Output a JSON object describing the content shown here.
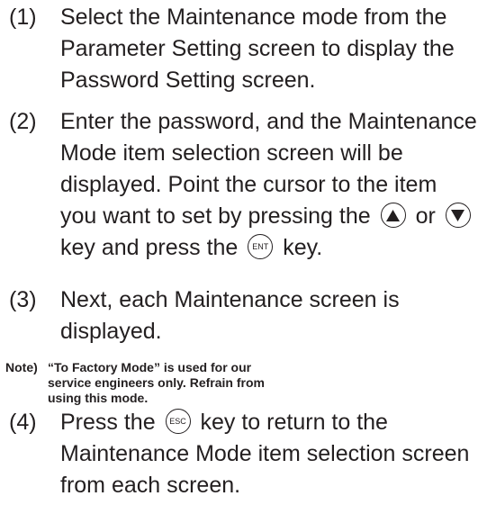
{
  "steps": [
    {
      "num": "(1)",
      "lines": [
        "Select the Maintenance mode from the",
        "Parameter Setting screen to display the",
        "Password Setting screen."
      ]
    },
    {
      "num": "(2)",
      "lines": [
        "Enter the password, and the Maintenance",
        "Mode item selection screen will be",
        "displayed. Point the cursor to the item"
      ],
      "line4": {
        "pre": "you want to set by pressing the",
        "mid": "or"
      },
      "line5": {
        "pre": "key and press the",
        "post": "key."
      }
    },
    {
      "num": "(3)",
      "lines": [
        "Next, each Maintenance screen is",
        "displayed."
      ]
    },
    {
      "num": "(4)",
      "line1": {
        "pre": "Press the",
        "post": "key to return to the"
      },
      "lines": [
        "Maintenance Mode item selection screen",
        "from each screen."
      ]
    }
  ],
  "note": {
    "head": "Note)",
    "lines": [
      "“To Factory Mode” is used for our",
      "service engineers only. Refrain from",
      "using this mode."
    ]
  },
  "keys": {
    "up": "up-arrow-icon",
    "down": "down-arrow-icon",
    "enter": "ENT",
    "escape": "ESC"
  }
}
